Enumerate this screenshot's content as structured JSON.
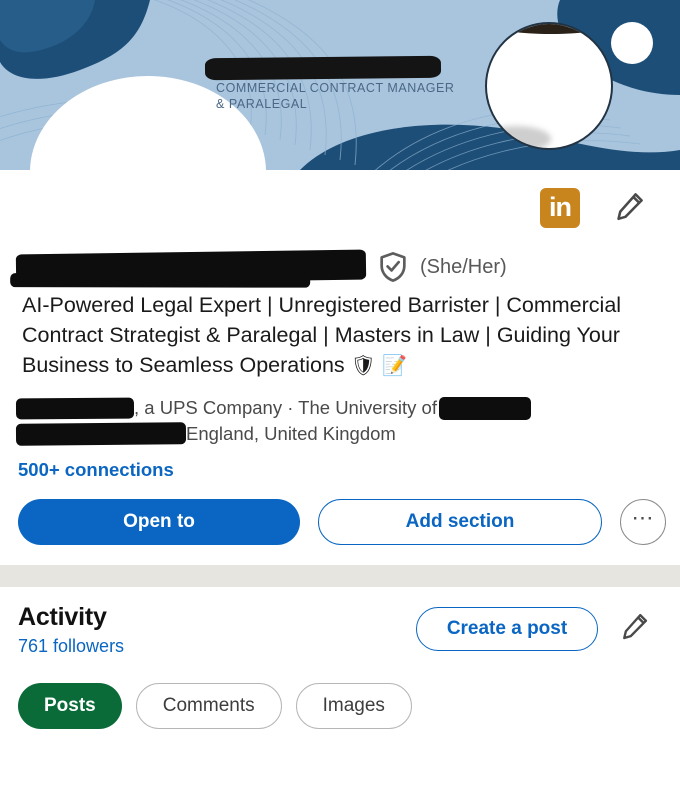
{
  "banner": {
    "tagline_line1": "COMMERCIAL CONTRACT MANAGER",
    "tagline_line2": "& PARALEGAL",
    "name_redacted": "",
    "edit_icon": "pencil-icon",
    "base_color": "#a9c5de",
    "blob_color": "#1d4e77",
    "text_color": "#4a6785"
  },
  "header_icons": {
    "premium_label": "in",
    "premium_color": "#c8851d",
    "edit_icon": "pencil-icon"
  },
  "identity": {
    "name_redacted": "",
    "verified_icon": "verified-shield-icon",
    "pronouns": "(She/Her)",
    "headline": "AI-Powered Legal Expert | Unregistered Barrister | Commercial Contract Strategist & Paralegal | Masters in Law | Guiding Your Business to Seamless Operations",
    "headline_emoji_shield": "🛡",
    "headline_emoji_memo": "📝",
    "company_suffix": ", a UPS Company · The University of",
    "location": "England, United Kingdom",
    "connections": "500+ connections"
  },
  "actions": {
    "open_to": "Open to",
    "add_section": "Add section",
    "more": "⋯",
    "primary_color": "#0a66c2"
  },
  "activity": {
    "title": "Activity",
    "followers": "761 followers",
    "create_post": "Create a post",
    "edit_icon": "pencil-icon",
    "filters": [
      {
        "label": "Posts",
        "active": true,
        "color": "#0a6b38"
      },
      {
        "label": "Comments",
        "active": false
      },
      {
        "label": "Images",
        "active": false
      }
    ]
  }
}
